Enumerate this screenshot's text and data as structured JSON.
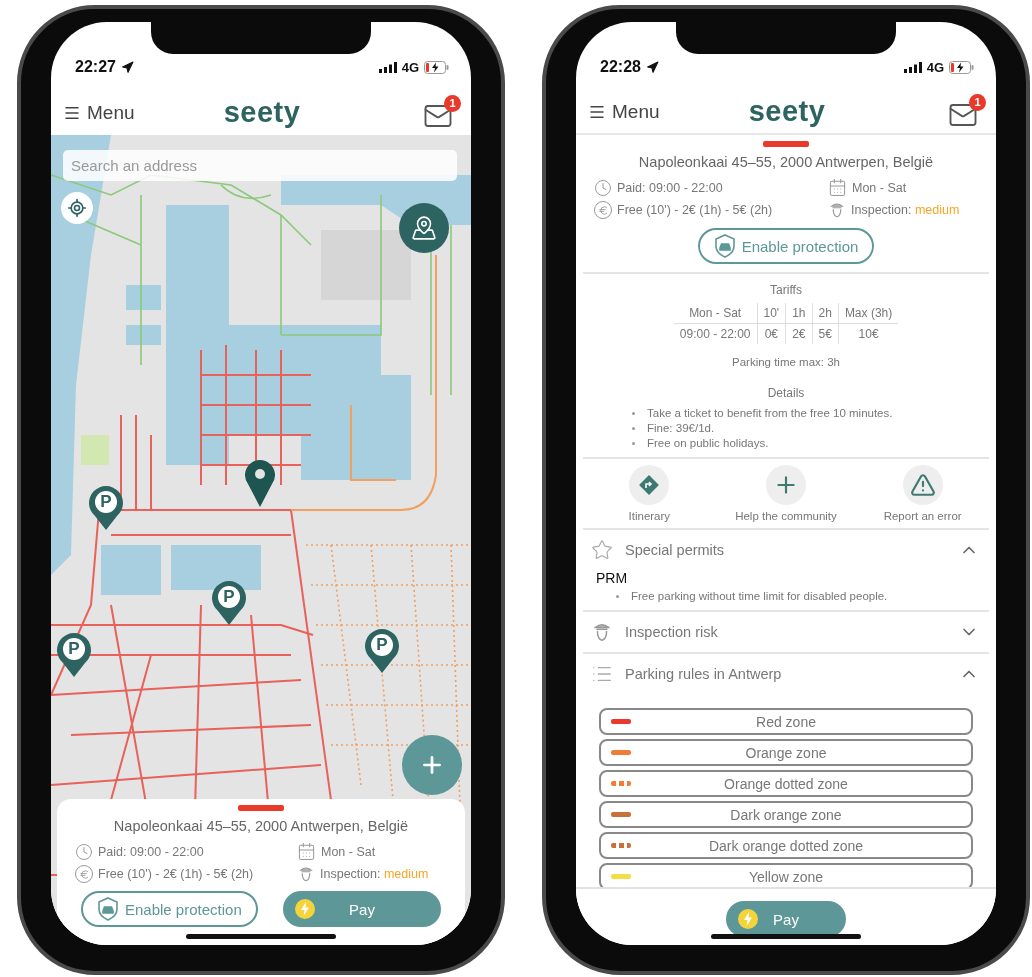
{
  "screens": [
    {
      "kind": "map",
      "status_bar": {
        "time": "22:27",
        "network": "4G"
      },
      "header": {
        "menu_label": "Menu",
        "logo": "seety",
        "badge": "1"
      },
      "search": {
        "placeholder": "Search an address"
      },
      "parking_markers": [
        {
          "label": "P"
        },
        {
          "label": "P"
        },
        {
          "label": "P"
        },
        {
          "label": "P"
        }
      ],
      "card": {
        "address": "Napoleonkaai 45–55, 2000 Antwerpen, België",
        "paid": "Paid: 09:00 - 22:00",
        "days": "Mon - Sat",
        "prices": "Free (10') - 2€ (1h) - 5€ (2h)",
        "inspection_label": "Inspection:",
        "inspection_level": "medium"
      },
      "buttons": {
        "protection": "Enable protection",
        "pay": "Pay"
      }
    },
    {
      "kind": "details",
      "status_bar": {
        "time": "22:28",
        "network": "4G"
      },
      "header": {
        "menu_label": "Menu",
        "logo": "seety",
        "badge": "1"
      },
      "card": {
        "address": "Napoleonkaai 45–55, 2000 Antwerpen, België",
        "paid": "Paid: 09:00 - 22:00",
        "days": "Mon - Sat",
        "prices": "Free (10') - 2€ (1h) - 5€ (2h)",
        "inspection_label": "Inspection:",
        "inspection_level": "medium"
      },
      "buttons": {
        "protection": "Enable protection",
        "pay": "Pay"
      },
      "tariffs": {
        "title": "Tariffs",
        "columns": [
          "Mon - Sat",
          "10'",
          "1h",
          "2h",
          "Max (3h)"
        ],
        "rows": [
          [
            "09:00 - 22:00",
            "0€",
            "2€",
            "5€",
            "10€"
          ]
        ],
        "max_time": "Parking time max: 3h"
      },
      "details": {
        "title": "Details",
        "bullets": [
          "Take a ticket to benefit from the free 10 minutes.",
          "Fine: 39€/1d.",
          "Free on public holidays."
        ]
      },
      "actions": [
        {
          "kind": "itinerary",
          "label": "Itinerary"
        },
        {
          "kind": "add",
          "label": "Help the community"
        },
        {
          "kind": "report",
          "label": "Report an error"
        }
      ],
      "sections": [
        {
          "kind": "permits",
          "title": "Special permits",
          "expanded": true,
          "permits": [
            {
              "name": "PRM",
              "bullets": [
                "Free parking without time limit for disabled people."
              ]
            }
          ]
        },
        {
          "kind": "inspection",
          "title": "Inspection risk",
          "expanded": false
        },
        {
          "kind": "rules",
          "title": "Parking rules in Antwerp",
          "expanded": true,
          "zones": [
            {
              "label": "Red zone",
              "kind": "solid",
              "color": "#e8392b"
            },
            {
              "label": "Orange zone",
              "kind": "solid",
              "color": "#f07c3a"
            },
            {
              "label": "Orange dotted zone",
              "kind": "dotted",
              "color": "#f07c3a"
            },
            {
              "label": "Dark orange zone",
              "kind": "solid",
              "color": "#c8703a"
            },
            {
              "label": "Dark orange dotted zone",
              "kind": "dotted",
              "color": "#c8703a"
            },
            {
              "label": "Yellow zone",
              "kind": "solid",
              "color": "#f6dd45"
            }
          ]
        }
      ]
    }
  ]
}
